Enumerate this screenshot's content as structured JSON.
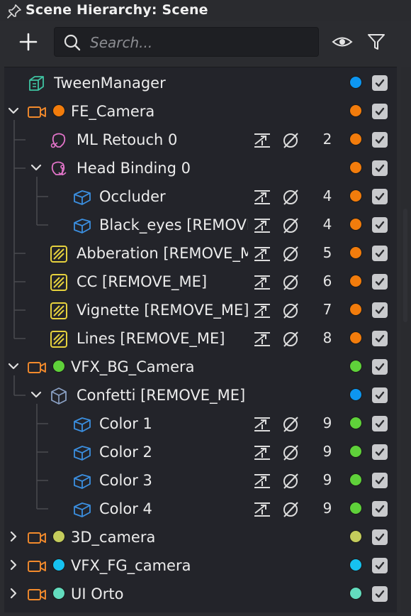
{
  "panel": {
    "title": "Scene Hierarchy: Scene"
  },
  "search": {
    "placeholder": "Search..."
  },
  "colors": {
    "blue": "#0d96f0",
    "orange": "#f27c0c",
    "green": "#5fd13a",
    "olive": "#c4cc5c",
    "cyan": "#16c2f0",
    "teal": "#63dcbe",
    "checkbox": "#c9cacd"
  },
  "rows": [
    {
      "label": "TweenManager",
      "icon": "cube-manager-icon",
      "count": "",
      "color": "#0d96f0"
    },
    {
      "label": "FE_Camera",
      "icon": "camera-icon",
      "count": "",
      "color": "#f27c0c",
      "expanded": true
    },
    {
      "label": "ML Retouch 0",
      "icon": "face-retouch-icon",
      "count": "2",
      "color": "#f27c0c"
    },
    {
      "label": "Head Binding 0",
      "icon": "head-binding-icon",
      "count": "",
      "color": "#f27c0c",
      "expanded": true
    },
    {
      "label": "Occluder",
      "icon": "mesh-icon",
      "count": "4",
      "color": "#f27c0c"
    },
    {
      "label": "Black_eyes [REMOVE_ME]",
      "icon": "mesh-icon",
      "count": "4",
      "color": "#f27c0c"
    },
    {
      "label": "Abberation [REMOVE_ME]",
      "icon": "post-effect-icon",
      "count": "5",
      "color": "#f27c0c"
    },
    {
      "label": "CC [REMOVE_ME]",
      "icon": "post-effect-icon",
      "count": "6",
      "color": "#f27c0c"
    },
    {
      "label": "Vignette [REMOVE_ME]",
      "icon": "post-effect-icon",
      "count": "7",
      "color": "#f27c0c"
    },
    {
      "label": "Lines [REMOVE_ME]",
      "icon": "post-effect-icon",
      "count": "8",
      "color": "#f27c0c"
    },
    {
      "label": "VFX_BG_Camera",
      "icon": "camera-icon",
      "count": "",
      "color": "#5fd13a",
      "expanded": true
    },
    {
      "label": "Confetti [REMOVE_ME]",
      "icon": "object-icon",
      "count": "",
      "color": "#0d96f0",
      "expanded": true
    },
    {
      "label": "Color 1",
      "icon": "mesh-icon",
      "count": "9",
      "color": "#5fd13a"
    },
    {
      "label": "Color 2",
      "icon": "mesh-icon",
      "count": "9",
      "color": "#5fd13a"
    },
    {
      "label": "Color 3",
      "icon": "mesh-icon",
      "count": "9",
      "color": "#5fd13a"
    },
    {
      "label": "Color 4",
      "icon": "mesh-icon",
      "count": "9",
      "color": "#5fd13a"
    },
    {
      "label": "3D_camera",
      "icon": "camera-icon",
      "count": "",
      "color": "#c4cc5c",
      "expanded": false
    },
    {
      "label": "VFX_FG_camera",
      "icon": "camera-icon",
      "count": "",
      "color": "#16c2f0",
      "expanded": false
    },
    {
      "label": "UI Orto",
      "icon": "camera-icon",
      "count": "",
      "color": "#63dcbe",
      "expanded": false
    }
  ]
}
